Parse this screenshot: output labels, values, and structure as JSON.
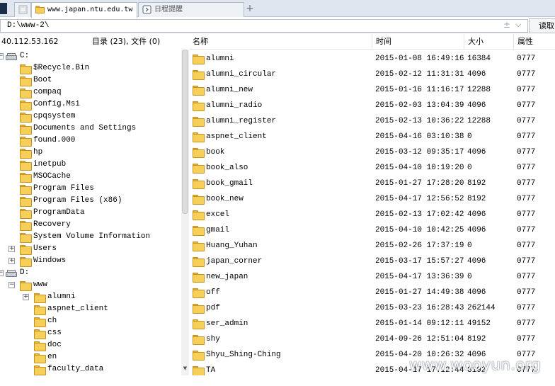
{
  "tabs": [
    {
      "label": "",
      "active": false
    },
    {
      "label": "www.japan.ntu.edu.tw",
      "active": true
    },
    {
      "label": "日程提醒",
      "active": false
    }
  ],
  "tab_add_label": "+",
  "address": {
    "value": "D:\\www-2\\",
    "read_button": "读取"
  },
  "left_header": {
    "ip": "40.112.53.162",
    "summary": "目录 (23), 文件 (0)"
  },
  "tree": [
    {
      "label": "C:",
      "kind": "drive",
      "expander": "minus"
    },
    {
      "label": "$Recycle.Bin",
      "kind": "folder"
    },
    {
      "label": "Boot",
      "kind": "folder"
    },
    {
      "label": "compaq",
      "kind": "folder"
    },
    {
      "label": "Config.Msi",
      "kind": "folder"
    },
    {
      "label": "cpqsystem",
      "kind": "folder"
    },
    {
      "label": "Documents and Settings",
      "kind": "folder"
    },
    {
      "label": "found.000",
      "kind": "folder"
    },
    {
      "label": "hp",
      "kind": "folder"
    },
    {
      "label": "inetpub",
      "kind": "folder"
    },
    {
      "label": "MSOCache",
      "kind": "folder"
    },
    {
      "label": "Program Files",
      "kind": "folder"
    },
    {
      "label": "Program Files (x86)",
      "kind": "folder"
    },
    {
      "label": "ProgramData",
      "kind": "folder"
    },
    {
      "label": "Recovery",
      "kind": "folder"
    },
    {
      "label": "System Volume Information",
      "kind": "folder"
    },
    {
      "label": "Users",
      "kind": "folder",
      "expander": "plus"
    },
    {
      "label": "Windows",
      "kind": "folder",
      "expander": "plus"
    },
    {
      "label": "D:",
      "kind": "drive",
      "expander": "minus"
    },
    {
      "label": "www",
      "kind": "folder",
      "expander": "minus"
    },
    {
      "label": "alumni",
      "kind": "folder",
      "expander": "plus"
    },
    {
      "label": "aspnet_client",
      "kind": "folder"
    },
    {
      "label": "ch",
      "kind": "folder"
    },
    {
      "label": "css",
      "kind": "folder"
    },
    {
      "label": "doc",
      "kind": "folder"
    },
    {
      "label": "en",
      "kind": "folder"
    },
    {
      "label": "faculty_data",
      "kind": "folder"
    }
  ],
  "columns": {
    "name": "名称",
    "time": "时间",
    "size": "大小",
    "attr": "属性"
  },
  "files": [
    {
      "name": "alumni",
      "time": "2015-01-08 16:49:16",
      "size": "16384",
      "attr": "0777"
    },
    {
      "name": "alumni_circular",
      "time": "2015-02-12 11:31:31",
      "size": "4096",
      "attr": "0777"
    },
    {
      "name": "alumni_new",
      "time": "2015-01-16 11:16:17",
      "size": "12288",
      "attr": "0777"
    },
    {
      "name": "alumni_radio",
      "time": "2015-02-03 13:04:39",
      "size": "4096",
      "attr": "0777"
    },
    {
      "name": "alumni_register",
      "time": "2015-02-13 10:36:22",
      "size": "12288",
      "attr": "0777"
    },
    {
      "name": "aspnet_client",
      "time": "2015-04-16 03:10:38",
      "size": "0",
      "attr": "0777"
    },
    {
      "name": "book",
      "time": "2015-03-12 09:35:17",
      "size": "4096",
      "attr": "0777"
    },
    {
      "name": "book_also",
      "time": "2015-04-10 10:19:20",
      "size": "0",
      "attr": "0777"
    },
    {
      "name": "book_gmail",
      "time": "2015-01-27 17:28:20",
      "size": "8192",
      "attr": "0777"
    },
    {
      "name": "book_new",
      "time": "2015-04-17 12:56:52",
      "size": "8192",
      "attr": "0777"
    },
    {
      "name": "excel",
      "time": "2015-02-13 17:02:42",
      "size": "4096",
      "attr": "0777"
    },
    {
      "name": "gmail",
      "time": "2015-04-10 10:42:25",
      "size": "4096",
      "attr": "0777"
    },
    {
      "name": "Huang_Yuhan",
      "time": "2015-02-26 17:37:19",
      "size": "0",
      "attr": "0777"
    },
    {
      "name": "japan_corner",
      "time": "2015-03-17 15:57:27",
      "size": "4096",
      "attr": "0777"
    },
    {
      "name": "new_japan",
      "time": "2015-04-17 13:36:39",
      "size": "0",
      "attr": "0777"
    },
    {
      "name": "off",
      "time": "2015-01-27 14:49:38",
      "size": "4096",
      "attr": "0777"
    },
    {
      "name": "pdf",
      "time": "2015-03-23 16:28:43",
      "size": "262144",
      "attr": "0777"
    },
    {
      "name": "ser_admin",
      "time": "2015-01-14 09:12:11",
      "size": "49152",
      "attr": "0777"
    },
    {
      "name": "shy",
      "time": "2014-09-26 12:51:04",
      "size": "8192",
      "attr": "0777"
    },
    {
      "name": "Shyu_Shing-Ching",
      "time": "2015-04-20 10:26:32",
      "size": "4096",
      "attr": "0777"
    },
    {
      "name": "TA",
      "time": "2015-04-17 17:12:44",
      "size": "8192",
      "attr": "0777"
    }
  ],
  "watermark": "www.wooyun.org"
}
